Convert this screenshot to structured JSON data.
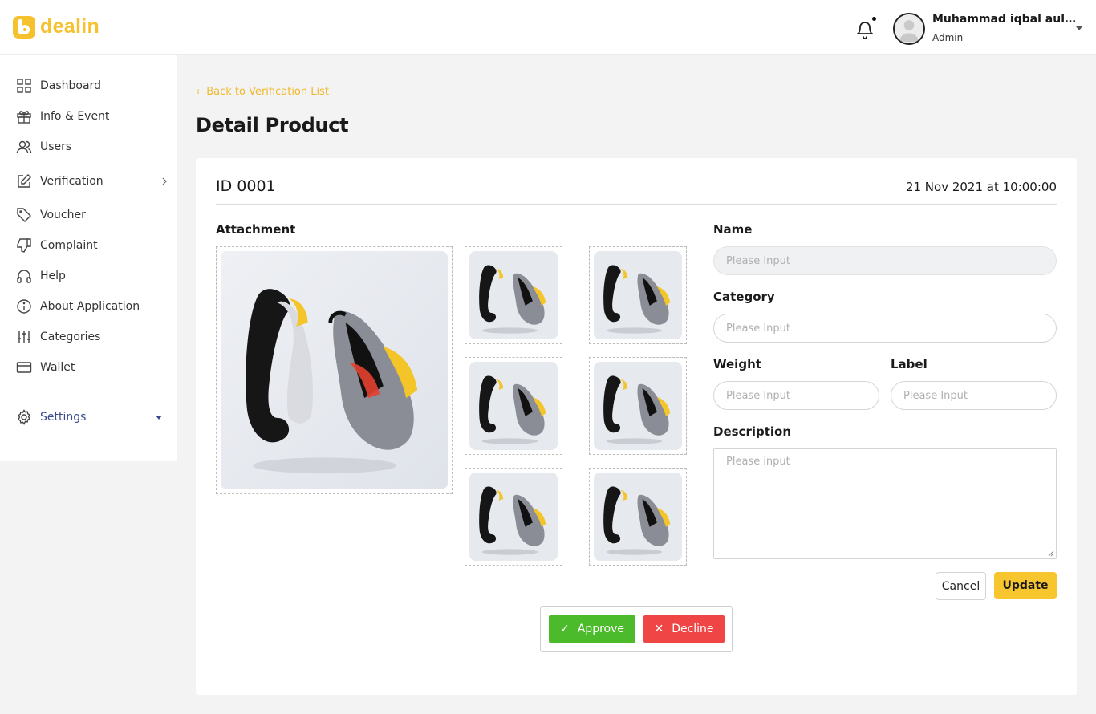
{
  "brand": {
    "name": "dealin",
    "color": "#f6c12f"
  },
  "header": {
    "user_name": "Muhammad iqbal aulia...",
    "user_role": "Admin",
    "icons": [
      "bell-icon",
      "avatar",
      "caret-down-icon"
    ]
  },
  "sidebar": {
    "items": [
      {
        "label": "Dashboard",
        "icon": "grid-icon"
      },
      {
        "label": "Info & Event",
        "icon": "gift-icon"
      },
      {
        "label": "Users",
        "icon": "users-icon"
      },
      {
        "label": "Verification",
        "icon": "edit-icon"
      },
      {
        "label": "Voucher",
        "icon": "tag-icon"
      },
      {
        "label": "Complaint",
        "icon": "thumbs-down-icon"
      },
      {
        "label": "Help",
        "icon": "headphones-icon"
      },
      {
        "label": "About Application",
        "icon": "info-icon"
      },
      {
        "label": "Categories",
        "icon": "sliders-icon"
      },
      {
        "label": "Wallet",
        "icon": "card-icon"
      },
      {
        "label": "Settings",
        "icon": "gear-icon"
      }
    ]
  },
  "page": {
    "back_label": "Back to Verification List",
    "title": "Detail Product"
  },
  "product": {
    "id_label": "ID 0001",
    "date": "21 Nov 2021 at 10:00:00",
    "attachment_label": "Attachment"
  },
  "form": {
    "name_label": "Name",
    "name_placeholder": "Please Input",
    "category_label": "Category",
    "category_placeholder": "Please Input",
    "weight_label": "Weight",
    "weight_placeholder": "Please Input",
    "label_label": "Label",
    "label_placeholder": "Please Input",
    "description_label": "Description",
    "description_placeholder": "Please input",
    "cancel_label": "Cancel",
    "update_label": "Update"
  },
  "actions": {
    "approve_label": "Approve",
    "decline_label": "Decline",
    "approve_color": "#4cbb2b",
    "decline_color": "#ef4545"
  }
}
